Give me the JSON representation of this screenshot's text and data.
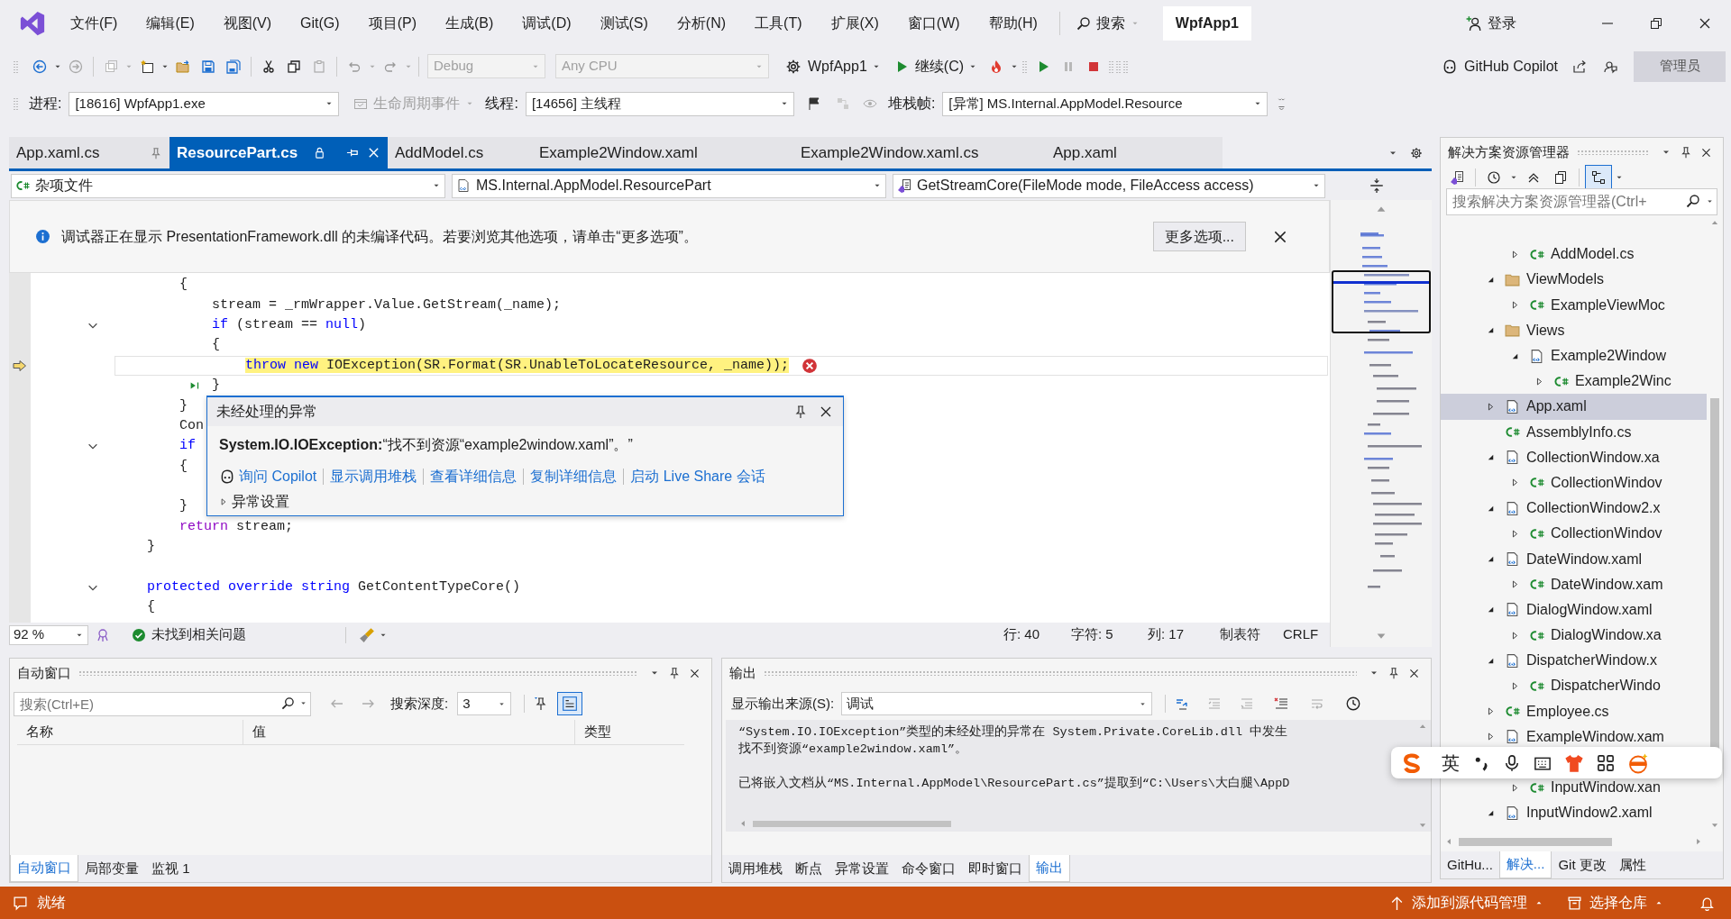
{
  "window": {
    "title": "WpfApp1",
    "search": "搜索",
    "sign_in": "登录"
  },
  "menu": [
    "文件(F)",
    "编辑(E)",
    "视图(V)",
    "Git(G)",
    "项目(P)",
    "生成(B)",
    "调试(D)",
    "测试(S)",
    "分析(N)",
    "工具(T)",
    "扩展(X)",
    "窗口(W)",
    "帮助(H)"
  ],
  "toolbar": {
    "configuration": {
      "value": "Debug",
      "disabled": true
    },
    "platform": {
      "value": "Any CPU",
      "disabled": true
    },
    "startup_project": "WpfApp1",
    "continue": "继续(C)",
    "copilot": "GitHub Copilot",
    "admin": "管理员"
  },
  "debug_toolbar": {
    "process_label": "进程:",
    "process": "[18616] WpfApp1.exe",
    "lifecycle": {
      "label": "生命周期事件",
      "disabled": true
    },
    "thread_label": "线程:",
    "thread": "[14656] 主线程",
    "stack_label": "堆栈帧:",
    "stack_frame": "[异常] MS.Internal.AppModel.Resource"
  },
  "editor": {
    "tabs": [
      {
        "label": "App.xaml.cs",
        "selected": false,
        "pinned": true,
        "read_only": false
      },
      {
        "label": "ResourcePart.cs",
        "selected": true,
        "pinned": false,
        "read_only": true
      },
      {
        "label": "AddModel.cs",
        "selected": false,
        "pinned": false,
        "read_only": false
      },
      {
        "label": "Example2Window.xaml",
        "selected": false,
        "pinned": false,
        "read_only": false
      },
      {
        "label": "Example2Window.xaml.cs",
        "selected": false,
        "pinned": false,
        "read_only": false
      },
      {
        "label": "App.xaml",
        "selected": false,
        "pinned": false,
        "read_only": false
      }
    ],
    "navigation": [
      "杂项文件",
      "MS.Internal.AppModel.ResourcePart",
      "GetStreamCore(FileMode mode, FileAccess access)"
    ],
    "info_bar": {
      "message": "调试器正在显示 PresentationFramework.dll 的未编译代码。若要浏览其他选项，请单击“更多选项”。",
      "button": "更多选项..."
    },
    "lines": [
      {
        "children": [
          {
            "tokens": [
              {
                "text": "{",
                "kind": "plain"
              }
            ],
            "foldable": false,
            "current": false,
            "children": [
              {
                "tokens": [
                  {
                    "text": "stream = _rmWrapper.Value.GetStream(_name);",
                    "kind": "plain"
                  }
                ],
                "foldable": false,
                "current": false
              },
              {
                "tokens": [
                  {
                    "text": "if ",
                    "kind": "keyword"
                  },
                  {
                    "text": "(stream == ",
                    "kind": "plain"
                  },
                  {
                    "text": "null",
                    "kind": "keyword"
                  },
                  {
                    "text": ")",
                    "kind": "plain"
                  }
                ],
                "foldable": true,
                "current": false
              },
              {
                "tokens": [
                  {
                    "text": "{",
                    "kind": "plain"
                  }
                ],
                "foldable": false,
                "current": false,
                "children": [
                  {
                    "tokens": [
                      {
                        "text": "throw new ",
                        "kind": "keyword"
                      },
                      {
                        "text": "IOException(SR.Format(SR.UnableToLocateResource, _name));",
                        "kind": "plain"
                      }
                    ],
                    "foldable": false,
                    "current": true
                  }
                ]
              },
              {
                "tokens": [
                  {
                    "text": "}",
                    "kind": "plain"
                  }
                ],
                "foldable": false,
                "current": false
              }
            ]
          },
          {
            "tokens": [
              {
                "text": "}",
                "kind": "plain"
              }
            ],
            "foldable": false,
            "current": false
          },
          {
            "tokens": [
              {
                "text": "Con",
                "kind": "plain"
              }
            ],
            "foldable": false,
            "current": false
          },
          {
            "tokens": [
              {
                "text": "if",
                "kind": "keyword"
              }
            ],
            "foldable": true,
            "current": false
          },
          {
            "tokens": [
              {
                "text": "{",
                "kind": "plain"
              }
            ],
            "foldable": false,
            "current": false,
            "children": [
              {
                "foldable": false,
                "current": false
              }
            ]
          },
          {
            "tokens": [
              {
                "text": "}",
                "kind": "plain"
              }
            ],
            "foldable": false,
            "current": false
          },
          {
            "tokens": [
              {
                "text": "return",
                "kind": "control"
              },
              {
                "text": " stream;",
                "kind": "plain"
              }
            ],
            "foldable": false,
            "current": false
          }
        ]
      },
      {
        "tokens": [
          {
            "text": "}",
            "kind": "plain"
          }
        ],
        "foldable": false,
        "current": false
      },
      {
        "foldable": false,
        "current": false
      },
      {
        "tokens": [
          {
            "text": "protected override string ",
            "kind": "keyword"
          },
          {
            "text": "GetContentTypeCore()",
            "kind": "plain"
          }
        ],
        "foldable": true,
        "current": false
      },
      {
        "tokens": [
          {
            "text": "{",
            "kind": "plain"
          }
        ],
        "foldable": false,
        "current": false
      }
    ],
    "exception": {
      "title": "未经处理的异常",
      "message": "**System.IO.IOException:**“找不到资源“example2window.xaml”。”",
      "links": [
        "询问 Copilot",
        "显示调用堆栈",
        "查看详细信息",
        "复制详细信息",
        "启动 Live Share 会话"
      ],
      "settings": {
        "label": "异常设置",
        "expanded": false
      }
    },
    "status": {
      "zoom": "92 %",
      "issues": "未找到相关问题",
      "line": "行: 40",
      "char": "字符: 5",
      "col": "列: 17",
      "indent": "制表符",
      "eol": "CRLF"
    }
  },
  "autos": {
    "title": "自动窗口",
    "search_placeholder": "搜索(Ctrl+E)",
    "depth_label": "搜索深度:",
    "depth": "3",
    "columns": [
      "名称",
      "值",
      "类型"
    ],
    "tabs": [
      {
        "label": "自动窗口",
        "selected": true
      },
      {
        "label": "局部变量",
        "selected": false
      },
      {
        "label": "监视 1",
        "selected": false
      }
    ]
  },
  "output": {
    "title": "输出",
    "source_label": "显示输出来源(S):",
    "source": "调试",
    "paragraphs": [
      [
        "“System.IO.IOException”类型的未经处理的异常在 System.Private.CoreLib.dll 中发生",
        "找不到资源“example2window.xaml”。"
      ],
      [
        "已将嵌入文档从“MS.Internal.AppModel\\ResourcePart.cs”提取到“C:\\Users\\大白腿\\AppD"
      ]
    ],
    "tabs": [
      {
        "label": "调用堆栈",
        "selected": false
      },
      {
        "label": "断点",
        "selected": false
      },
      {
        "label": "异常设置",
        "selected": false
      },
      {
        "label": "命令窗口",
        "selected": false
      },
      {
        "label": "即时窗口",
        "selected": false
      },
      {
        "label": "输出",
        "selected": true
      }
    ]
  },
  "solution_explorer": {
    "title": "解决方案资源管理器",
    "search_placeholder": "搜索解决方案资源管理器(Ctrl+",
    "tree": [
      {
        "children": [
          {
            "label": "AddModel.cs",
            "kind": "cs",
            "expanded": false,
            "selected": false
          }
        ]
      },
      {
        "label": "ViewModels",
        "kind": "folder",
        "expanded": true,
        "selected": false,
        "children": [
          {
            "label": "ExampleViewMoc",
            "kind": "cs",
            "expanded": false,
            "selected": false
          }
        ]
      },
      {
        "label": "Views",
        "kind": "folder",
        "expanded": true,
        "selected": false,
        "children": [
          {
            "label": "Example2Window",
            "kind": "xaml",
            "expanded": true,
            "selected": false,
            "children": [
              {
                "label": "Example2Winc",
                "kind": "cs",
                "expanded": false,
                "selected": false
              }
            ]
          }
        ]
      },
      {
        "label": "App.xaml",
        "kind": "xaml",
        "expanded": false,
        "selected": true
      },
      {
        "label": "AssemblyInfo.cs",
        "kind": "cs",
        "selected": false
      },
      {
        "label": "CollectionWindow.xa",
        "kind": "xaml",
        "expanded": true,
        "selected": false,
        "children": [
          {
            "label": "CollectionWindov",
            "kind": "cs",
            "expanded": false,
            "selected": false
          }
        ]
      },
      {
        "label": "CollectionWindow2.x",
        "kind": "xaml",
        "expanded": true,
        "selected": false,
        "children": [
          {
            "label": "CollectionWindov",
            "kind": "cs",
            "expanded": false,
            "selected": false
          }
        ]
      },
      {
        "label": "DateWindow.xaml",
        "kind": "xaml",
        "expanded": true,
        "selected": false,
        "children": [
          {
            "label": "DateWindow.xam",
            "kind": "cs",
            "expanded": false,
            "selected": false
          }
        ]
      },
      {
        "label": "DialogWindow.xaml",
        "kind": "xaml",
        "expanded": true,
        "selected": false,
        "children": [
          {
            "label": "DialogWindow.xa",
            "kind": "cs",
            "expanded": false,
            "selected": false
          }
        ]
      },
      {
        "label": "DispatcherWindow.x",
        "kind": "xaml",
        "expanded": true,
        "selected": false,
        "children": [
          {
            "label": "DispatcherWindo",
            "kind": "cs",
            "expanded": false,
            "selected": false
          }
        ]
      },
      {
        "label": "Employee.cs",
        "kind": "cs",
        "expanded": false,
        "selected": false
      },
      {
        "label": "ExampleWindow.xam",
        "kind": "xaml",
        "expanded": false,
        "selected": false
      },
      {
        "children": [
          {
            "label": "InputWindow.xan",
            "kind": "cs",
            "expanded": false,
            "selected": false
          }
        ]
      },
      {
        "label": "InputWindow2.xaml",
        "kind": "xaml",
        "expanded": true,
        "selected": false
      }
    ],
    "tabs": [
      {
        "label": "GitHu...",
        "selected": false
      },
      {
        "label": "解决...",
        "selected": true
      },
      {
        "label": "Git 更改",
        "selected": false
      },
      {
        "label": "属性",
        "selected": false
      }
    ]
  },
  "ime": {
    "mode": "英"
  },
  "status_bar": {
    "message": "就绪",
    "source_control": "添加到源代码管理",
    "repository": "选择仓库"
  }
}
